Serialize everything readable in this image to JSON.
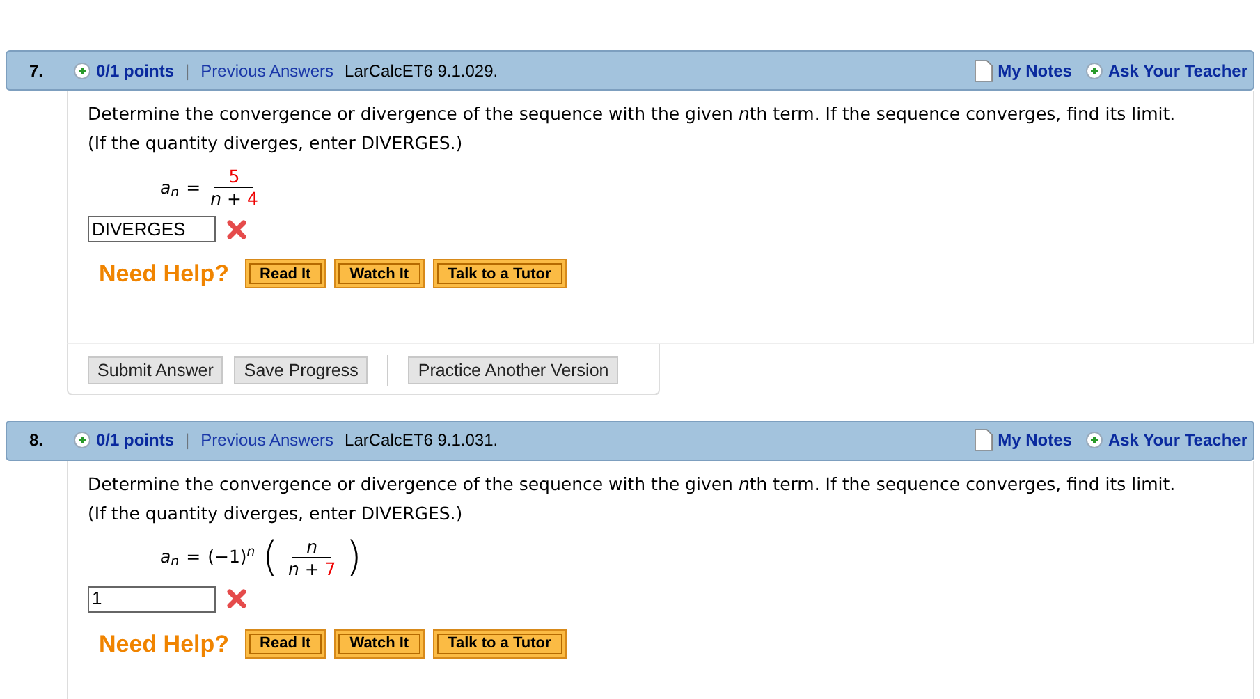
{
  "questions": [
    {
      "number": "7.",
      "points": "0/1 points",
      "separator": "|",
      "previous_answers": "Previous Answers",
      "source": "LarCalcET6 9.1.029.",
      "my_notes": "My Notes",
      "ask_teacher": "Ask Your Teacher",
      "prompt": [
        [
          {
            "text": "Determine the convergence or divergence of the sequence with the given ",
            "kind": "plain"
          },
          {
            "text": "n",
            "kind": "var"
          },
          {
            "text": "th term. If the sequence converges, find its limit.",
            "kind": "plain"
          }
        ],
        [
          {
            "text": "(If the quantity diverges, enter DIVERGES.)",
            "kind": "plain"
          }
        ]
      ],
      "formula": {
        "lhs": "a",
        "lhs_sub": "n",
        "equals": "=",
        "numerator": [
          {
            "text": "5",
            "kind": "num"
          }
        ],
        "denominator": [
          {
            "text": "n",
            "kind": "var"
          },
          {
            "text": " + ",
            "kind": "op"
          },
          {
            "text": "4",
            "kind": "num"
          }
        ]
      },
      "answer": {
        "value": "DIVERGES",
        "correct": false
      },
      "help": {
        "label": "Need Help?",
        "buttons": [
          "Read It",
          "Watch It",
          "Talk to a Tutor"
        ]
      },
      "footer_buttons": [
        "Submit Answer",
        "Save Progress"
      ],
      "footer_extra_buttons": [
        "Practice Another Version"
      ]
    },
    {
      "number": "8.",
      "points": "0/1 points",
      "separator": "|",
      "previous_answers": "Previous Answers",
      "source": "LarCalcET6 9.1.031.",
      "my_notes": "My Notes",
      "ask_teacher": "Ask Your Teacher",
      "prompt": [
        [
          {
            "text": "Determine the convergence or divergence of the sequence with the given ",
            "kind": "plain"
          },
          {
            "text": "n",
            "kind": "var"
          },
          {
            "text": "th term. If the sequence converges, find its limit.",
            "kind": "plain"
          }
        ],
        [
          {
            "text": "(If the quantity diverges, enter DIVERGES.)",
            "kind": "plain"
          }
        ]
      ],
      "formula": {
        "lhs": "a",
        "lhs_sub": "n",
        "equals": "=",
        "factor": {
          "base": "(−1)",
          "sup": "n"
        },
        "open": "(",
        "close": ")",
        "numerator": [
          {
            "text": "n",
            "kind": "var"
          }
        ],
        "denominator": [
          {
            "text": "n",
            "kind": "var"
          },
          {
            "text": " + ",
            "kind": "op"
          },
          {
            "text": "7",
            "kind": "num"
          }
        ]
      },
      "answer": {
        "value": "1",
        "correct": false
      },
      "help": {
        "label": "Need Help?",
        "buttons": [
          "Read It",
          "Watch It",
          "Talk to a Tutor"
        ]
      }
    }
  ]
}
